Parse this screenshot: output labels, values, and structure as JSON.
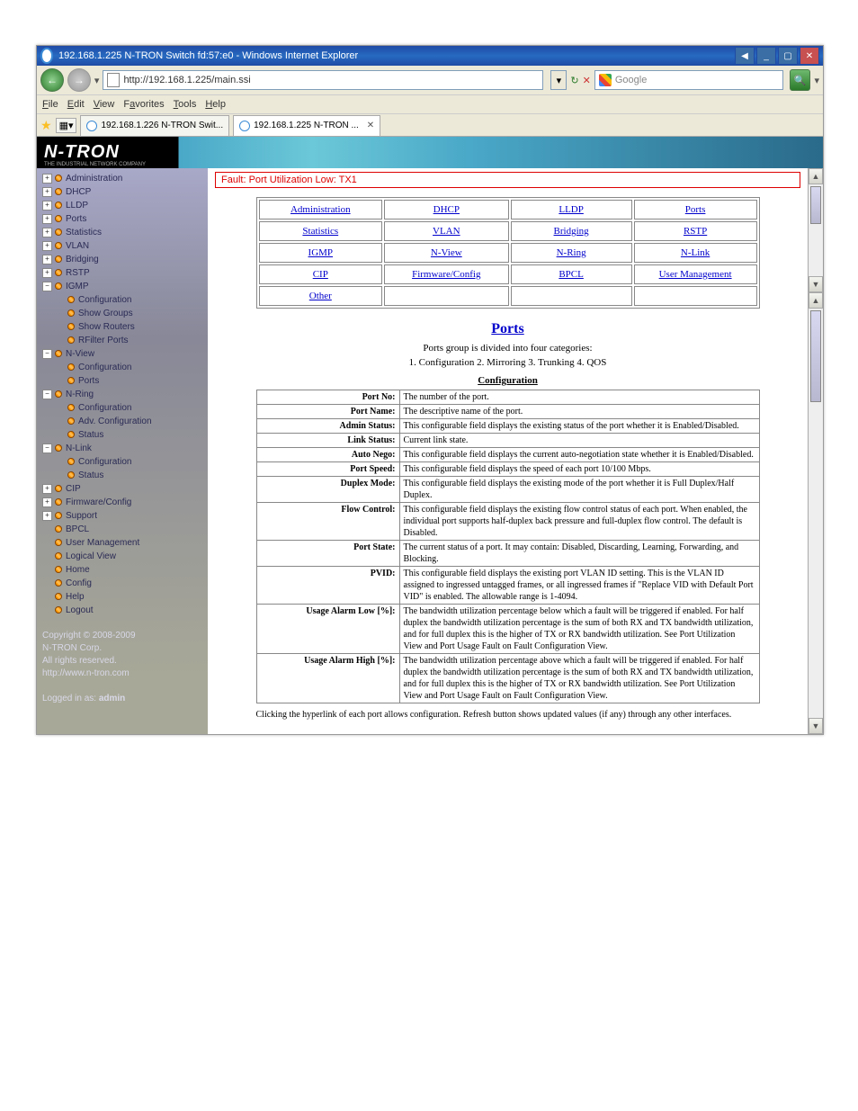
{
  "window": {
    "title": "192.168.1.225 N-TRON Switch fd:57:e0 - Windows Internet Explorer",
    "url": "http://192.168.1.225/main.ssi",
    "searchPlaceholder": "Google"
  },
  "menu": [
    "File",
    "Edit",
    "View",
    "Favorites",
    "Tools",
    "Help"
  ],
  "tabs": {
    "t1": "192.168.1.226 N-TRON Swit...",
    "t2": "192.168.1.225 N-TRON ..."
  },
  "banner": {
    "logo": "N-TRON",
    "sub": "THE INDUSTRIAL NETWORK COMPANY"
  },
  "tree": {
    "administration": "Administration",
    "dhcp": "DHCP",
    "lldp": "LLDP",
    "ports": "Ports",
    "statistics": "Statistics",
    "vlan": "VLAN",
    "bridging": "Bridging",
    "rstp": "RSTP",
    "igmp": "IGMP",
    "igmp_configuration": "Configuration",
    "igmp_show_groups": "Show Groups",
    "igmp_show_routers": "Show Routers",
    "igmp_rfilter": "RFilter Ports",
    "nview": "N-View",
    "nview_configuration": "Configuration",
    "nview_ports": "Ports",
    "nring": "N-Ring",
    "nring_configuration": "Configuration",
    "nring_adv": "Adv. Configuration",
    "nring_status": "Status",
    "nlink": "N-Link",
    "nlink_configuration": "Configuration",
    "nlink_status": "Status",
    "cip": "CIP",
    "firmware": "Firmware/Config",
    "support": "Support",
    "bpcl": "BPCL",
    "usermgmt": "User Management",
    "logical": "Logical View",
    "home": "Home",
    "config": "Config",
    "help": "Help",
    "logout": "Logout"
  },
  "footer": {
    "copyright": "Copyright © 2008-2009",
    "corp": "N-TRON Corp.",
    "rights": "All rights reserved.",
    "url": "http://www.n-tron.com",
    "loggedin": "Logged in as:",
    "user": "admin"
  },
  "fault": "Fault:  Port Utilization Low: TX1",
  "grid": {
    "r1c1": "Administration",
    "r1c2": "DHCP",
    "r1c3": "LLDP",
    "r1c4": "Ports",
    "r2c1": "Statistics",
    "r2c2": "VLAN",
    "r2c3": "Bridging",
    "r2c4": "RSTP",
    "r3c1": "IGMP",
    "r3c2": "N-View",
    "r3c3": "N-Ring",
    "r3c4": "N-Link",
    "r4c1": "CIP",
    "r4c2": "Firmware/Config",
    "r4c3": "BPCL",
    "r4c4": "User Management",
    "r5c1": "Other"
  },
  "page": {
    "title": "Ports",
    "intro1": "Ports group is divided into four categories:",
    "intro2": "1. Configuration   2. Mirroring   3. Trunking   4. QOS",
    "config_head": "Configuration"
  },
  "defs": {
    "port_no": {
      "k": "Port No:",
      "v": "The number of the port."
    },
    "port_name": {
      "k": "Port Name:",
      "v": "The descriptive name of the port."
    },
    "admin": {
      "k": "Admin Status:",
      "v": "This configurable field displays the existing status of the port whether it is Enabled/Disabled."
    },
    "link": {
      "k": "Link Status:",
      "v": "Current link state."
    },
    "auto": {
      "k": "Auto Nego:",
      "v": "This configurable field displays the current auto-negotiation state whether it is Enabled/Disabled."
    },
    "speed": {
      "k": "Port Speed:",
      "v": "This configurable field displays the speed of each port 10/100 Mbps."
    },
    "duplex": {
      "k": "Duplex Mode:",
      "v": "This configurable field displays the existing mode of the port whether it is Full Duplex/Half Duplex."
    },
    "flow": {
      "k": "Flow Control:",
      "v": "This configurable field displays the existing flow control status of each port. When enabled, the individual port supports half-duplex back pressure and full-duplex flow control. The default is Disabled."
    },
    "state": {
      "k": "Port State:",
      "v": "The current status of a port. It may contain: Disabled, Discarding, Learning, Forwarding, and Blocking."
    },
    "pvid": {
      "k": "PVID:",
      "v": "This configurable field displays the existing port VLAN ID setting. This is the VLAN ID assigned to ingressed untagged frames, or all ingressed frames if \"Replace VID with Default Port VID\" is enabled. The allowable range is 1-4094."
    },
    "alarmlow": {
      "k": "Usage Alarm Low [%]:",
      "v": "The bandwidth utilization percentage below which a fault will be triggered if enabled. For half duplex the bandwidth utilization percentage is the sum of both RX and TX bandwidth utilization, and for full duplex this is the higher of TX or RX bandwidth utilization. See Port Utilization View and Port Usage Fault on Fault Configuration View."
    },
    "alarmhigh": {
      "k": "Usage Alarm High [%]:",
      "v": "The bandwidth utilization percentage above which a fault will be triggered if enabled. For half duplex the bandwidth utilization percentage is the sum of both RX and TX bandwidth utilization, and for full duplex this is the higher of TX or RX bandwidth utilization. See Port Utilization View and Port Usage Fault on Fault Configuration View."
    }
  },
  "note": "Clicking the hyperlink of each port allows configuration. Refresh button shows updated values (if any) through any other interfaces."
}
